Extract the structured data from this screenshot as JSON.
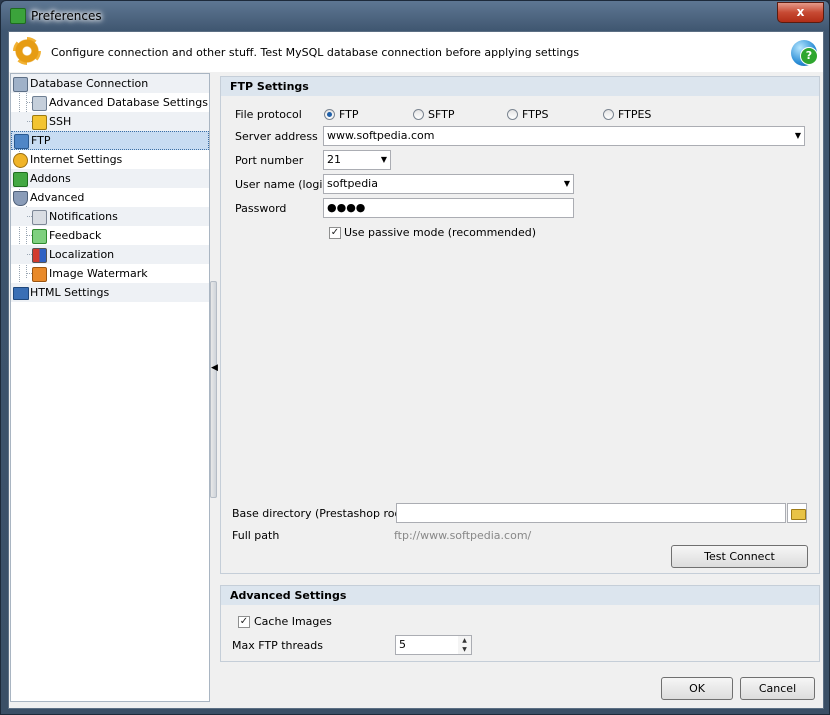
{
  "window": {
    "title": "Preferences",
    "close": "x"
  },
  "header": {
    "description": "Configure connection and other stuff. Test MySQL database connection before applying settings"
  },
  "tree": {
    "items": [
      {
        "label": "Database Connection"
      },
      {
        "label": "Advanced Database Settings"
      },
      {
        "label": "SSH"
      },
      {
        "label": "FTP"
      },
      {
        "label": "Internet Settings"
      },
      {
        "label": "Addons"
      },
      {
        "label": "Advanced"
      },
      {
        "label": "Notifications"
      },
      {
        "label": "Feedback"
      },
      {
        "label": "Localization"
      },
      {
        "label": "Image Watermark"
      },
      {
        "label": "HTML Settings"
      }
    ]
  },
  "ftp": {
    "section_title": "FTP Settings",
    "protocol_label": "File protocol",
    "protocols": [
      "FTP",
      "SFTP",
      "FTPS",
      "FTPES"
    ],
    "selected_protocol": "FTP",
    "server_label": "Server address",
    "server_value": "www.softpedia.com",
    "port_label": "Port number",
    "port_value": "21",
    "user_label": "User name (login)",
    "user_value": "softpedia",
    "password_label": "Password",
    "password_value": "●●●●",
    "passive_label": "Use passive mode (recommended)",
    "passive_checked": true,
    "basedir_label": "Base directory (Prestashop root)",
    "basedir_value": "",
    "fullpath_label": "Full path",
    "fullpath_value": "ftp://www.softpedia.com/",
    "test_button": "Test Connect"
  },
  "advanced": {
    "section_title": "Advanced Settings",
    "cache_label": "Cache Images",
    "cache_checked": true,
    "threads_label": "Max FTP threads",
    "threads_value": "5"
  },
  "buttons": {
    "ok": "OK",
    "cancel": "Cancel"
  },
  "icons": {
    "gear": "gear-icon",
    "help": "help-icon",
    "folder": "folder-open-icon",
    "dropdown": "chevron-down-icon"
  },
  "colors": {
    "selection": "#c8dcf2",
    "section_header": "#dce5ee",
    "accent": "#1f5fa8"
  }
}
